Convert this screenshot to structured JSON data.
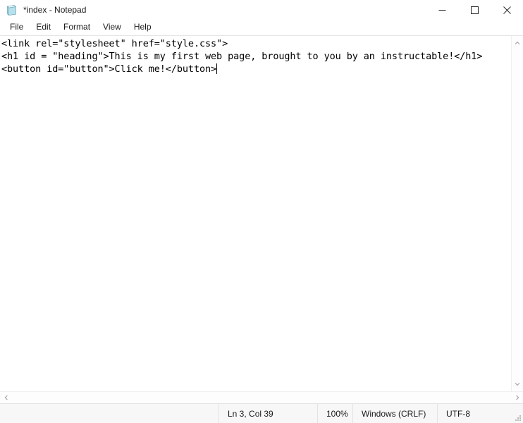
{
  "window": {
    "title": "*index - Notepad",
    "icon": "notepad-icon",
    "controls": {
      "minimize": "minimize-icon",
      "maximize": "maximize-icon",
      "close": "close-icon"
    }
  },
  "menubar": {
    "items": [
      {
        "label": "File"
      },
      {
        "label": "Edit"
      },
      {
        "label": "Format"
      },
      {
        "label": "View"
      },
      {
        "label": "Help"
      }
    ]
  },
  "editor": {
    "lines": [
      "<link rel=\"stylesheet\" href=\"style.css\">",
      "<h1 id = \"heading\">This is my first web page, brought to you by an instructable!</h1>",
      "<button id=\"button\">Click me!</button>"
    ],
    "caret_line": 3,
    "caret_col": 39
  },
  "scrollbars": {
    "vertical": {
      "up": "scroll-up-icon",
      "down": "scroll-down-icon"
    },
    "horizontal": {
      "left": "scroll-left-icon",
      "right": "scroll-right-icon"
    }
  },
  "statusbar": {
    "position": "Ln 3, Col 39",
    "zoom": "100%",
    "line_ending": "Windows (CRLF)",
    "encoding": "UTF-8"
  },
  "colors": {
    "window_bg": "#ffffff",
    "text": "#1b1b1b",
    "statusbar_bg": "#f7f7f7",
    "border": "#e3e3e3",
    "icon_blue": "#9fd6e6"
  }
}
